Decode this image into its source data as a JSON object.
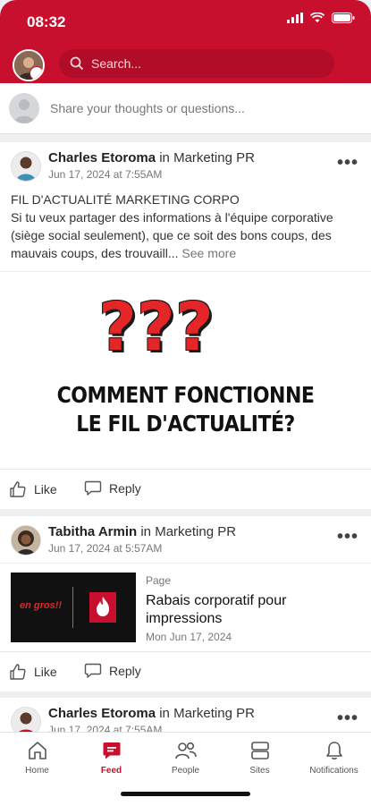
{
  "status_bar": {
    "time": "08:32"
  },
  "header": {
    "search_placeholder": "Search..."
  },
  "composer": {
    "placeholder": "Share your thoughts or questions..."
  },
  "posts": [
    {
      "author": "Charles Etoroma",
      "in_label": "in",
      "group": "Marketing PR",
      "timestamp": "Jun 17, 2024 at 7:55AM",
      "text_line1": "FIL D'ACTUALITÉ MARKETING CORPO",
      "text_body": "Si tu veux partager des informations à l'équipe corporative (siège social seulement), que ce soit des bons coups, des mauvais coups, des trouvaill...",
      "see_more": "See more",
      "image_marks": "???",
      "image_title_line1": "COMMENT FONCTIONNE",
      "image_title_line2": "LE FIL D'ACTUALITÉ?",
      "like_label": "Like",
      "reply_label": "Reply"
    },
    {
      "author": "Tabitha Armin",
      "in_label": "in",
      "group": "Marketing PR",
      "timestamp": "Jun 17, 2024 at 5:57AM",
      "link_kind": "Page",
      "link_title": "Rabais corporatif pour impressions",
      "link_date": "Mon Jun 17, 2024",
      "thumb_text": "en gros!!",
      "like_label": "Like",
      "reply_label": "Reply"
    },
    {
      "author": "Charles Etoroma",
      "in_label": "in",
      "group": "Marketing PR",
      "timestamp": "Jun 17, 2024 at 7:55AM"
    }
  ],
  "tabbar": {
    "items": [
      {
        "label": "Home",
        "icon": "home-icon"
      },
      {
        "label": "Feed",
        "icon": "feed-icon",
        "active": true
      },
      {
        "label": "People",
        "icon": "people-icon"
      },
      {
        "label": "Sites",
        "icon": "sites-icon"
      },
      {
        "label": "Notifications",
        "icon": "bell-icon"
      }
    ]
  },
  "colors": {
    "brand": "#c8102e",
    "accent_text": "#e52629"
  }
}
